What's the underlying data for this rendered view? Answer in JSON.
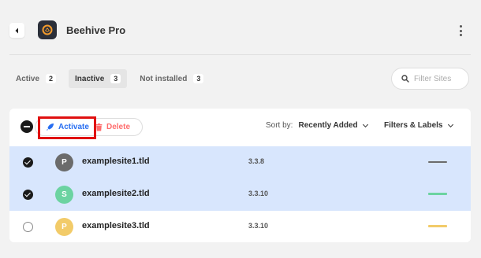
{
  "header": {
    "title": "Beehive Pro",
    "back_icon": "chevron-left-icon",
    "logo_icon": "beehive-logo-icon",
    "menu_icon": "more-vertical-icon"
  },
  "tabs": [
    {
      "label": "Active",
      "count": "2"
    },
    {
      "label": "Inactive",
      "count": "3"
    },
    {
      "label": "Not installed",
      "count": "3"
    }
  ],
  "search": {
    "placeholder": "Filter Sites",
    "value": ""
  },
  "toolbar": {
    "activate_label": "Activate",
    "delete_label": "Delete",
    "sort_label": "Sort by:",
    "sort_value": "Recently Added",
    "filters_label": "Filters & Labels"
  },
  "sites": [
    {
      "initial": "P",
      "name": "examplesite1.tld",
      "version": "3.3.8",
      "avatar_color": "#6b6b6b",
      "status_color": "#6b6b6b",
      "selected": true
    },
    {
      "initial": "S",
      "name": "examplesite2.tld",
      "version": "3.3.10",
      "avatar_color": "#6cd3a1",
      "status_color": "#6cd3a1",
      "selected": true
    },
    {
      "initial": "P",
      "name": "examplesite3.tld",
      "version": "3.3.10",
      "avatar_color": "#f2cb69",
      "status_color": "#f2cb69",
      "selected": false
    }
  ],
  "colors": {
    "accent": "#286ef1",
    "danger": "#ff6d6d",
    "highlight_box": "#e01010",
    "selected_row": "#d8e6fd"
  }
}
